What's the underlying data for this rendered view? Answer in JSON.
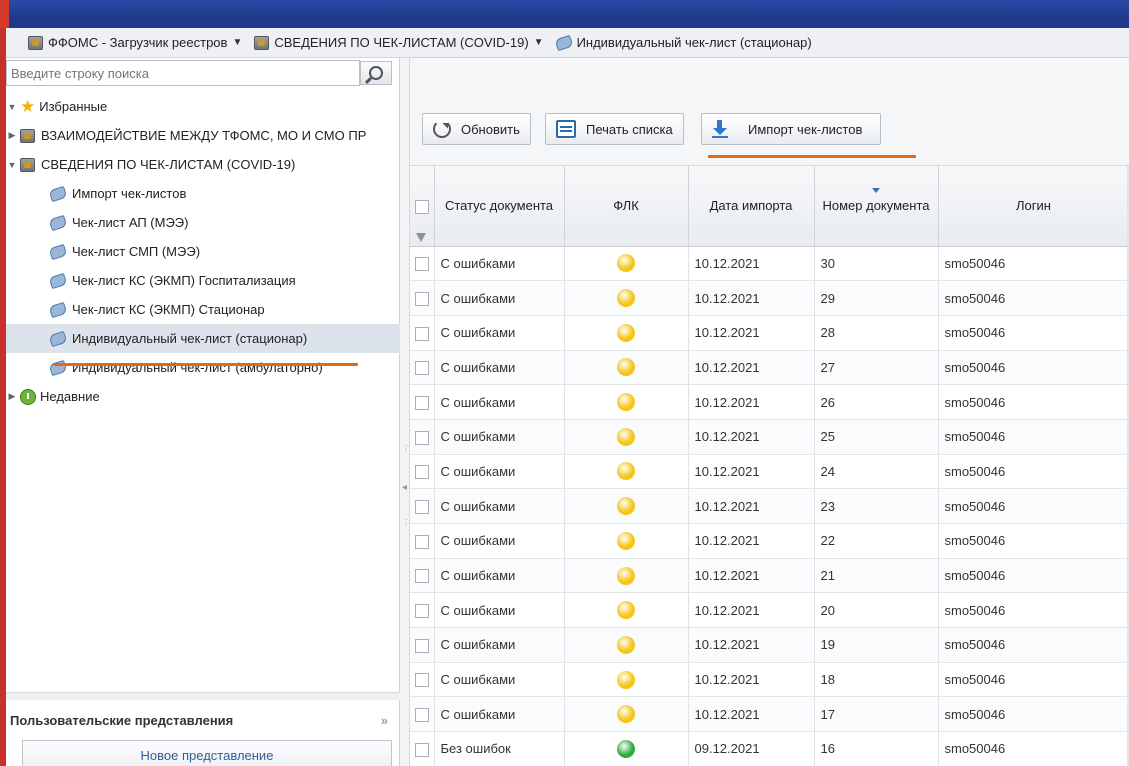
{
  "breadcrumb": [
    {
      "label": "ФФОМС - Загрузчик реестров",
      "caret": "▼"
    },
    {
      "label": "СВЕДЕНИЯ ПО ЧЕК-ЛИСТАМ (COVID-19)",
      "caret": "▼"
    },
    {
      "label": "Индивидуальный чек-лист (стационар)"
    }
  ],
  "search": {
    "placeholder": "Введите строку поиска"
  },
  "tree": {
    "favorites": "Избранные",
    "interaction": "ВЗАИМОДЕЙСТВИЕ МЕЖДУ ТФОМС, МО И СМО ПР",
    "covid_group": "СВЕДЕНИЯ ПО ЧЕК-ЛИСТАМ (COVID-19)",
    "children": [
      "Импорт чек-листов",
      "Чек-лист АП (МЭЭ)",
      "Чек-лист СМП (МЭЭ)",
      "Чек-лист КС (ЭКМП) Госпитализация",
      "Чек-лист КС (ЭКМП) Стационар",
      "Индивидуальный чек-лист (стационар)",
      "Индивидуальный чек-лист (амбулаторно)"
    ],
    "recent": "Недавние"
  },
  "user_views": {
    "title": "Пользовательские представления",
    "new_view": "Новое представление"
  },
  "toolbar": {
    "refresh": "Обновить",
    "print": "Печать списка",
    "import": "Импорт чек-листов"
  },
  "table": {
    "headers": [
      "Статус документа",
      "ФЛК",
      "Дата импорта",
      "Номер документа",
      "Логин"
    ],
    "rows": [
      {
        "status": "С ошибками",
        "flk": "yellow",
        "date": "10.12.2021",
        "num": "30",
        "login": "smo50046"
      },
      {
        "status": "С ошибками",
        "flk": "yellow",
        "date": "10.12.2021",
        "num": "29",
        "login": "smo50046"
      },
      {
        "status": "С ошибками",
        "flk": "yellow",
        "date": "10.12.2021",
        "num": "28",
        "login": "smo50046"
      },
      {
        "status": "С ошибками",
        "flk": "yellow",
        "date": "10.12.2021",
        "num": "27",
        "login": "smo50046"
      },
      {
        "status": "С ошибками",
        "flk": "yellow",
        "date": "10.12.2021",
        "num": "26",
        "login": "smo50046"
      },
      {
        "status": "С ошибками",
        "flk": "yellow",
        "date": "10.12.2021",
        "num": "25",
        "login": "smo50046"
      },
      {
        "status": "С ошибками",
        "flk": "yellow",
        "date": "10.12.2021",
        "num": "24",
        "login": "smo50046"
      },
      {
        "status": "С ошибками",
        "flk": "yellow",
        "date": "10.12.2021",
        "num": "23",
        "login": "smo50046"
      },
      {
        "status": "С ошибками",
        "flk": "yellow",
        "date": "10.12.2021",
        "num": "22",
        "login": "smo50046"
      },
      {
        "status": "С ошибками",
        "flk": "yellow",
        "date": "10.12.2021",
        "num": "21",
        "login": "smo50046"
      },
      {
        "status": "С ошибками",
        "flk": "yellow",
        "date": "10.12.2021",
        "num": "20",
        "login": "smo50046"
      },
      {
        "status": "С ошибками",
        "flk": "yellow",
        "date": "10.12.2021",
        "num": "19",
        "login": "smo50046"
      },
      {
        "status": "С ошибками",
        "flk": "yellow",
        "date": "10.12.2021",
        "num": "18",
        "login": "smo50046"
      },
      {
        "status": "С ошибками",
        "flk": "yellow",
        "date": "10.12.2021",
        "num": "17",
        "login": "smo50046"
      },
      {
        "status": "Без ошибок",
        "flk": "green",
        "date": "09.12.2021",
        "num": "16",
        "login": "smo50046"
      }
    ]
  },
  "colors": {
    "accent_underline": "#e8661c",
    "flk_yellow": "#f5c518",
    "flk_green": "#2eaa3c",
    "selected_row": "#dde3ea"
  }
}
